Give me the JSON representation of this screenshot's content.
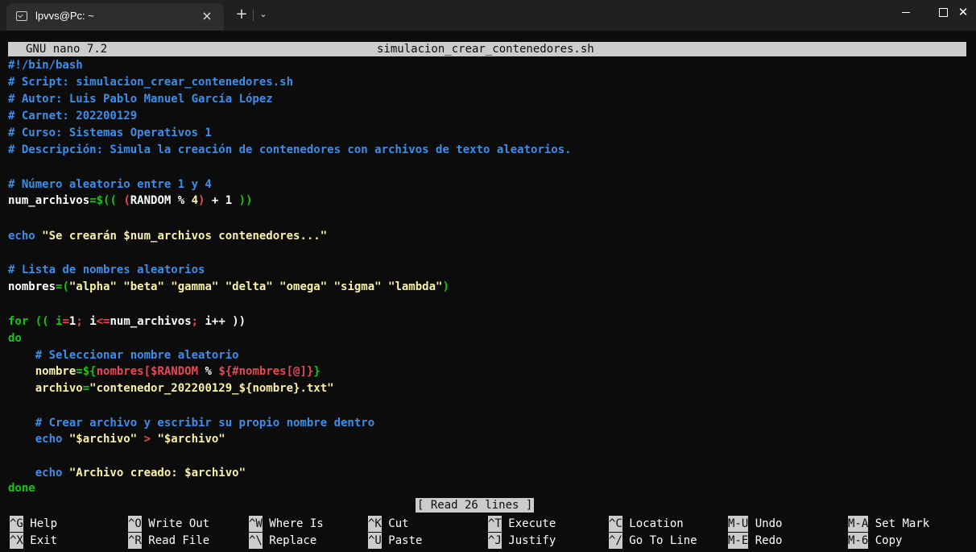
{
  "window": {
    "tab_title": "lpvvs@Pc: ~",
    "tab_close": "×",
    "new_tab": "+",
    "tab_dropdown": "⌄",
    "minimize": "",
    "maximize": "",
    "close": "✕"
  },
  "nano": {
    "version": "GNU nano 7.2",
    "filename": "simulacion_crear_contenedores.sh",
    "status_message": "[ Read 26 lines ]"
  },
  "code": {
    "l1": "#!/bin/bash",
    "l2": "# Script: simulacion_crear_contenedores.sh",
    "l3": "# Autor: Luis Pablo Manuel García López",
    "l4": "# Carnet: 202200129",
    "l5": "# Curso: Sistemas Operativos 1",
    "l6": "# Descripción: Simula la creación de contenedores con archivos de texto aleatorios.",
    "l8": "# Número aleatorio entre 1 y 4",
    "l9a": "num_archivos",
    "l9b": "=$(( ",
    "l9c": "(",
    "l9d": "RANDOM % ",
    "l9e": "4",
    "l9f": ")",
    "l9g": " + 1 ",
    "l9h": "))",
    "l11a": "echo ",
    "l11b": "\"Se crearán $num_archivos contenedores...\"",
    "l13": "# Lista de nombres aleatorios",
    "l14a": "nombres",
    "l14b": "=(",
    "l14c": "\"alpha\" \"beta\" \"gamma\" \"delta\" \"omega\" \"sigma\" \"lambda\"",
    "l14d": ")",
    "l16a": "for",
    "l16b": " (( i",
    "l16c": "=",
    "l16d": "1",
    "l16e": ";",
    "l16f": " i",
    "l16g": "<=",
    "l16h": "num_archivos",
    "l16i": ";",
    "l16j": " i++ ))",
    "l17": "do",
    "l18": "    # Seleccionar nombre aleatorio",
    "l19a": "    nombre",
    "l19b": "=${",
    "l19c": "nombres[$RANDOM",
    "l19d": " % ",
    "l19e": "${#nombres[@]}",
    "l19f": "}",
    "l20a": "    archivo",
    "l20b": "=",
    "l20c": "\"contenedor_202200129_${nombre}.txt\"",
    "l22": "    # Crear archivo y escribir su propio nombre dentro",
    "l23a": "    echo ",
    "l23b": "\"$archivo\"",
    "l23c": " > ",
    "l23d": "\"$archivo\"",
    "l25a": "    echo ",
    "l25b": "\"Archivo creado: $archivo\"",
    "l26": "done"
  },
  "shortcuts": [
    {
      "key": "^G",
      "label": " Help"
    },
    {
      "key": "^O",
      "label": " Write Out"
    },
    {
      "key": "^W",
      "label": " Where Is"
    },
    {
      "key": "^K",
      "label": " Cut"
    },
    {
      "key": "^T",
      "label": " Execute"
    },
    {
      "key": "^C",
      "label": " Location"
    },
    {
      "key": "M-U",
      "label": " Undo"
    },
    {
      "key": "M-A",
      "label": " Set Mark"
    },
    {
      "key": "^X",
      "label": " Exit"
    },
    {
      "key": "^R",
      "label": " Read File"
    },
    {
      "key": "^\\",
      "label": " Replace"
    },
    {
      "key": "^U",
      "label": " Paste"
    },
    {
      "key": "^J",
      "label": " Justify"
    },
    {
      "key": "^/",
      "label": " Go To Line"
    },
    {
      "key": "M-E",
      "label": " Redo"
    },
    {
      "key": "M-6",
      "label": " Copy"
    }
  ],
  "colors": {
    "background": "#0c0c0c",
    "comment": "#3b8eea",
    "string": "#f9f1a5",
    "operator": "#16c60c",
    "variable_expansion": "#e74856",
    "header_bar": "#cccccc"
  }
}
